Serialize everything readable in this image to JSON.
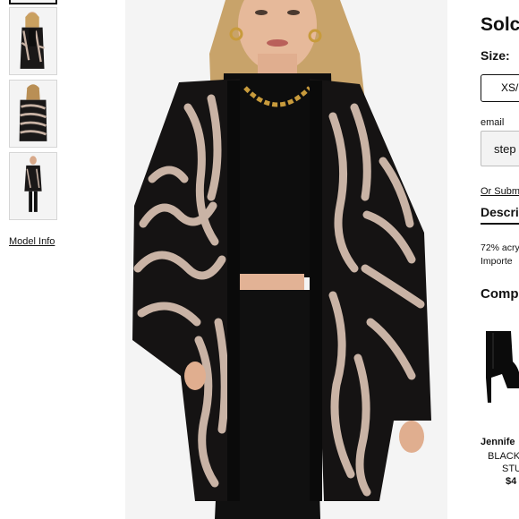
{
  "gallery": {
    "thumbnails": [
      {
        "view": "front-crop"
      },
      {
        "view": "front"
      },
      {
        "view": "back"
      },
      {
        "view": "full-length"
      }
    ],
    "model_info_label": "Model Info"
  },
  "product": {
    "status_title": "Solc",
    "size_label": "Size:",
    "selected_size": "XS/",
    "email_label": "email",
    "email_value": "step",
    "or_submit_label": "Or Subm",
    "description_tab": "Descri",
    "description_lines": [
      "72% acry",
      "Importe"
    ],
    "colors": {
      "primary": "#111111",
      "pattern_light": "#c9b3a5",
      "pattern_dark": "#151313"
    }
  },
  "complete_the_look": {
    "title": "Comp",
    "item": {
      "brand": "Jennife",
      "name_line1": "BLACK",
      "name_line2": "STU",
      "price": "$4",
      "icon": "black-heeled-boot-icon"
    }
  }
}
